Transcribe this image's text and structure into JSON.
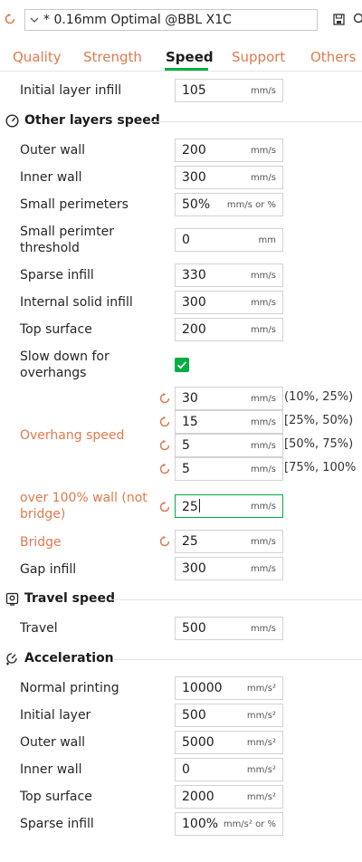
{
  "preset": {
    "name": "* 0.16mm Optimal @BBL X1C"
  },
  "tabs": [
    "Quality",
    "Strength",
    "Speed",
    "Support",
    "Others"
  ],
  "active_tab": "Speed",
  "colors": {
    "accent": "#00ae42",
    "modified": "#e07a4f"
  },
  "initial": {
    "label": "Initial layer infill",
    "value": "105",
    "unit": "mm/s"
  },
  "sections": {
    "other_layers": "Other layers speed",
    "travel": "Travel speed",
    "acceleration": "Acceleration"
  },
  "other": {
    "outer_wall": {
      "label": "Outer wall",
      "value": "200",
      "unit": "mm/s"
    },
    "inner_wall": {
      "label": "Inner wall",
      "value": "300",
      "unit": "mm/s"
    },
    "small_perimeters": {
      "label": "Small perimeters",
      "value": "50%",
      "unit": "mm/s or %"
    },
    "small_perimeter_threshold": {
      "label_l1": "Small perimter",
      "label_l2": "threshold",
      "value": "0",
      "unit": "mm"
    },
    "sparse_infill": {
      "label": "Sparse infill",
      "value": "330",
      "unit": "mm/s"
    },
    "internal_solid_infill": {
      "label": "Internal solid infill",
      "value": "300",
      "unit": "mm/s"
    },
    "top_surface": {
      "label": "Top surface",
      "value": "200",
      "unit": "mm/s"
    },
    "slow_down": {
      "label_l1": "Slow down for",
      "label_l2": "overhangs",
      "checked": true
    },
    "overhang": {
      "label": "Overhang speed",
      "rows": [
        {
          "value": "30",
          "unit": "mm/s",
          "range": "(10%, 25%)"
        },
        {
          "value": "15",
          "unit": "mm/s",
          "range": "[25%, 50%)"
        },
        {
          "value": "5",
          "unit": "mm/s",
          "range": "[50%, 75%)"
        },
        {
          "value": "5",
          "unit": "mm/s",
          "range": "[75%, 100%"
        }
      ]
    },
    "over100": {
      "label_l1": "over 100% wall (not",
      "label_l2": "bridge)",
      "value": "25",
      "unit": "mm/s"
    },
    "bridge": {
      "label": "Bridge",
      "value": "25",
      "unit": "mm/s"
    },
    "gap_infill": {
      "label": "Gap infill",
      "value": "300",
      "unit": "mm/s"
    }
  },
  "travel": {
    "label": "Travel",
    "value": "500",
    "unit": "mm/s"
  },
  "accel": {
    "normal_printing": {
      "label": "Normal printing",
      "value": "10000",
      "unit": "mm/s²"
    },
    "initial_layer": {
      "label": "Initial layer",
      "value": "500",
      "unit": "mm/s²"
    },
    "outer_wall": {
      "label": "Outer wall",
      "value": "5000",
      "unit": "mm/s²"
    },
    "inner_wall": {
      "label": "Inner wall",
      "value": "0",
      "unit": "mm/s²"
    },
    "top_surface": {
      "label": "Top surface",
      "value": "2000",
      "unit": "mm/s²"
    },
    "sparse_infill": {
      "label": "Sparse infill",
      "value": "100%",
      "unit": "mm/s² or %"
    }
  }
}
